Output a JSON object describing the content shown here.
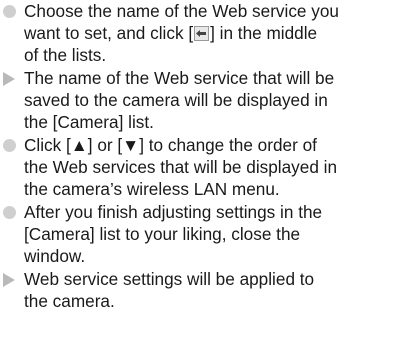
{
  "items": [
    {
      "marker": "bullet",
      "lines": [
        "Choose the name of the Web service you",
        "want to set, and click [",
        "] in the middle",
        "of the lists."
      ],
      "icon": "move-left-arrow-icon"
    },
    {
      "marker": "arrow",
      "lines": [
        "The name of the Web service that will be",
        "saved to the camera will be displayed in",
        "the [Camera] list."
      ]
    },
    {
      "marker": "bullet",
      "lines": [
        "Click [▲] or [▼] to change the order of",
        "the Web services that will be displayed in",
        "the camera’s wireless LAN menu."
      ]
    },
    {
      "marker": "bullet",
      "lines": [
        "After you finish adjusting settings in the",
        "[Camera] list to your liking, close the",
        "window."
      ]
    },
    {
      "marker": "arrow",
      "lines": [
        "Web service settings will be applied to",
        "the camera."
      ]
    }
  ],
  "colors": {
    "text": "#1a1a1a",
    "bullet": "#cfcfcf",
    "arrow": "#b9b9b9"
  }
}
